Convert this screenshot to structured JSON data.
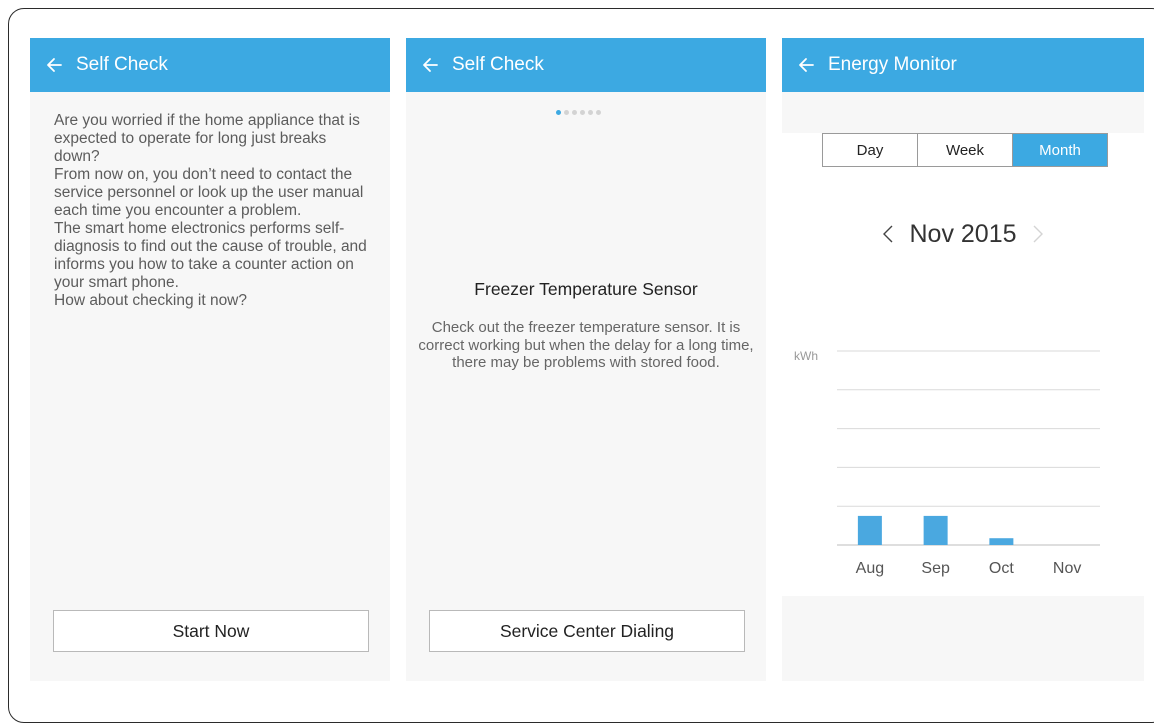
{
  "screens": [
    {
      "title": "Self Check",
      "body": "Are you worried if the home appliance that is expected to operate for long just breaks down?\nFrom now on, you don’t need to contact the service personnel or look up the user manual each time you encounter a problem.\nThe smart home electronics performs self-diagnosis to find out the cause of trouble, and informs you how to take a counter action on your smart phone.\nHow about checking it now?",
      "button_label": "Start Now"
    },
    {
      "title": "Self Check",
      "page_indicator": {
        "total": 6,
        "current": 1
      },
      "item_title": "Freezer Temperature Sensor",
      "item_description": "Check out the freezer temperature sensor. It is correct working but when the delay for a long time, there may be problems with stored food.",
      "button_label": "Service Center Dialing"
    },
    {
      "title": "Energy Monitor",
      "tabs": [
        {
          "label": "Day",
          "active": false
        },
        {
          "label": "Week",
          "active": false
        },
        {
          "label": "Month",
          "active": true
        }
      ],
      "period_label": "Nov 2015"
    }
  ],
  "colors": {
    "accent": "#3ca9e2",
    "bar": "#4aa8e0"
  },
  "chart_data": {
    "type": "bar",
    "ylabel": "kWh",
    "categories": [
      "Aug",
      "Sep",
      "Oct",
      "Nov"
    ],
    "values": [
      1.5,
      1.5,
      0.35,
      0
    ],
    "ylim": [
      0,
      10
    ],
    "grid": true
  }
}
